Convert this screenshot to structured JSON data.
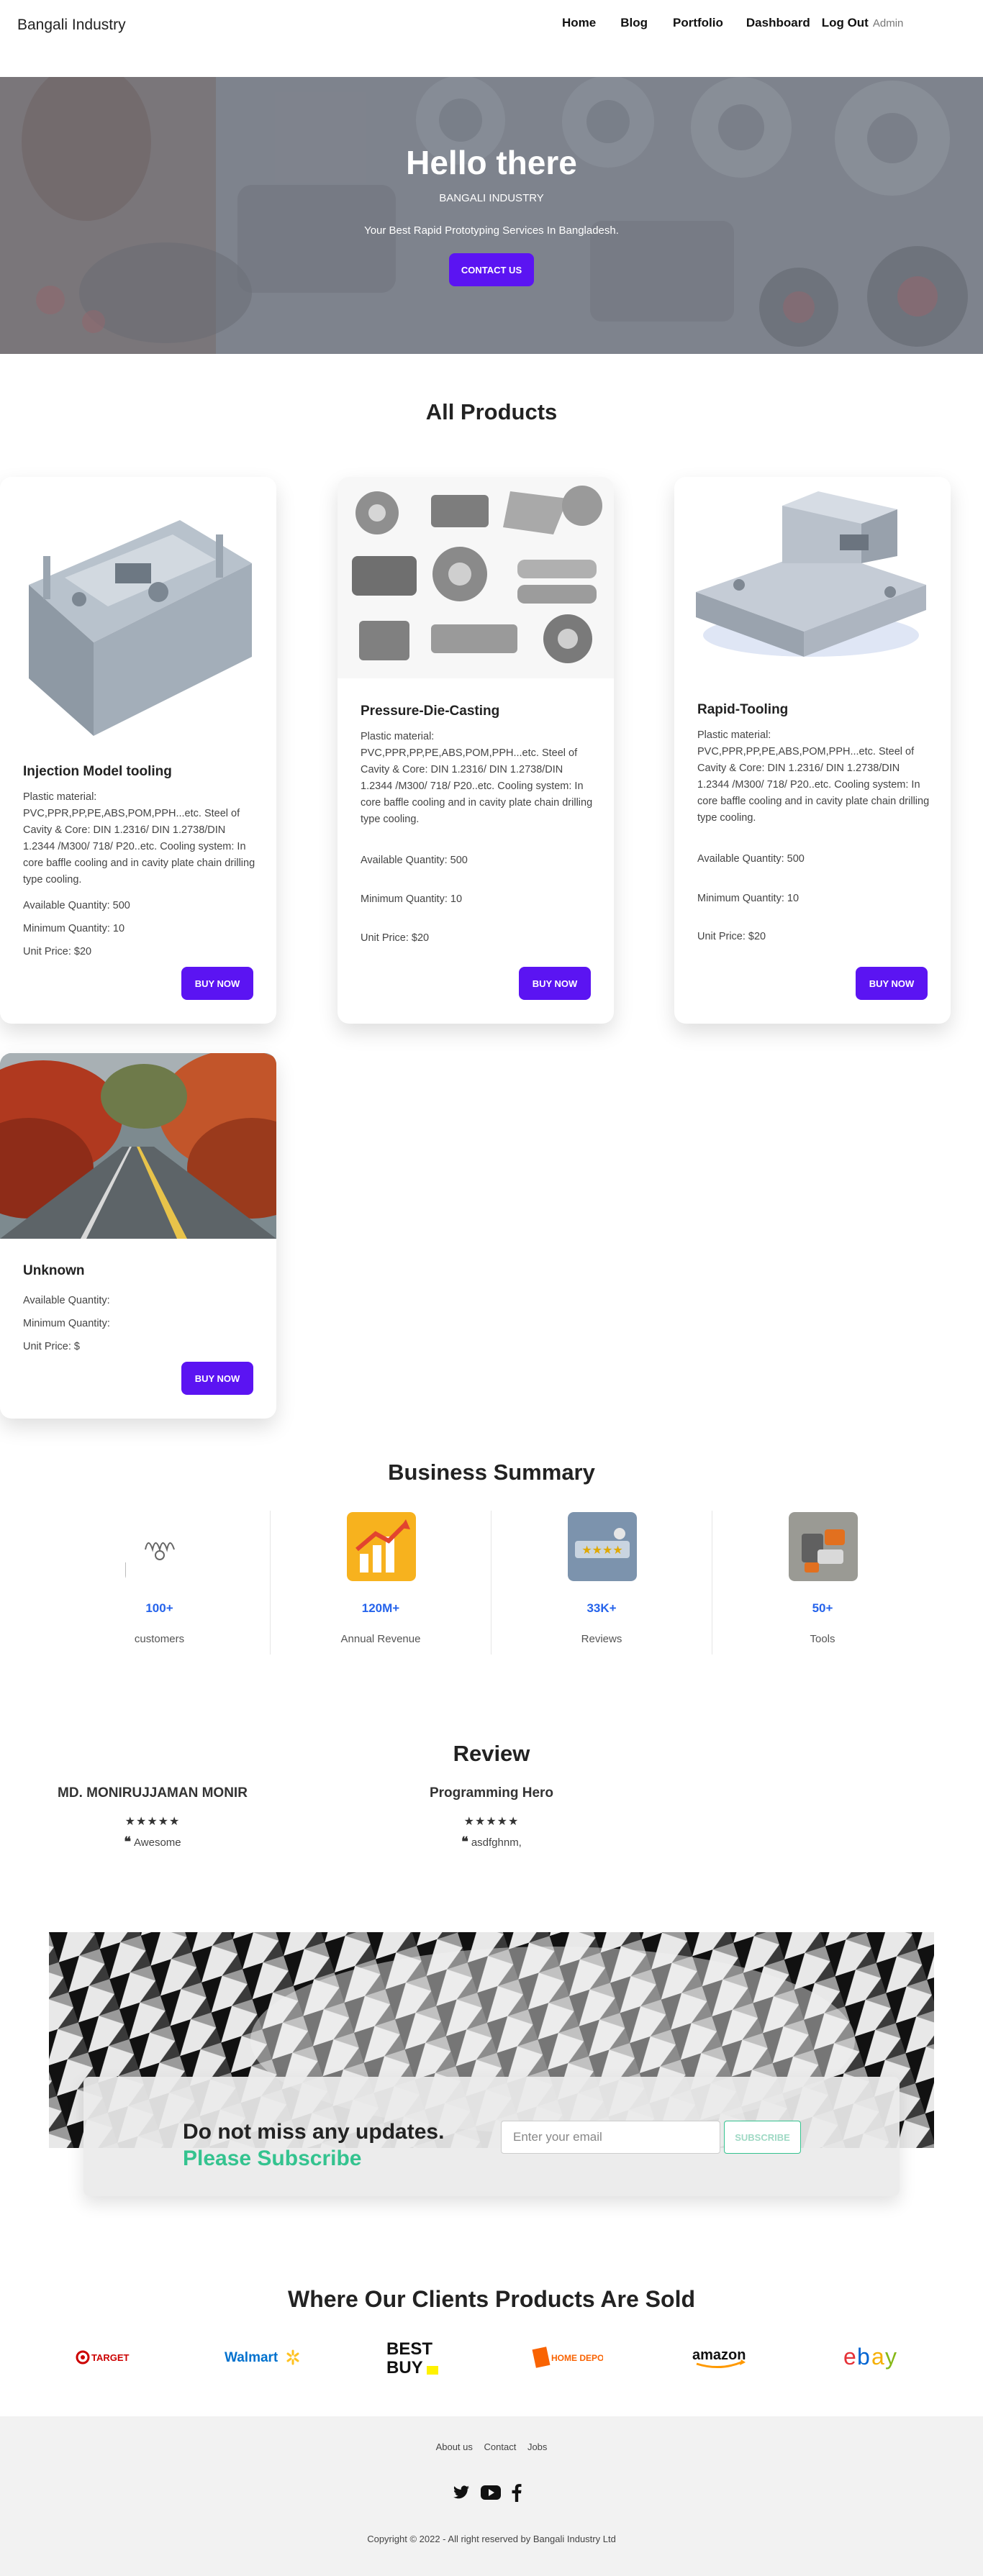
{
  "nav": {
    "brand": "Bangali Industry",
    "links": [
      "Home",
      "Blog",
      "Portfolio",
      "Dashboard",
      "Log Out"
    ],
    "user": "Admin"
  },
  "hero": {
    "title": "Hello there",
    "subtitle": "BANGALI INDUSTRY",
    "tagline": "Your Best Rapid Prototyping Services In Bangladesh.",
    "button": "CONTACT US"
  },
  "products": {
    "title": "All Products",
    "buy_label": "BUY NOW",
    "items": [
      {
        "name": "Injection Model tooling",
        "description": "Plastic material: PVC,PPR,PP,PE,ABS,POM,PPH...etc. Steel of Cavity & Core: DIN 1.2316/ DIN 1.2738/DIN 1.2344 /M300/ 718/ P20..etc. Cooling system: In core baffle cooling and in cavity plate chain drilling type cooling.",
        "available": "Available Quantity: 500",
        "minimum": "Minimum Quantity: 10",
        "price": "Unit Price: $20"
      },
      {
        "name": "Pressure-Die-Casting",
        "description": "Plastic material: PVC,PPR,PP,PE,ABS,POM,PPH...etc. Steel of Cavity & Core: DIN 1.2316/ DIN 1.2738/DIN 1.2344 /M300/ 718/ P20..etc. Cooling system: In core baffle cooling and in cavity plate chain drilling type cooling.",
        "available": "Available Quantity: 500",
        "minimum": "Minimum Quantity: 10",
        "price": "Unit Price: $20"
      },
      {
        "name": "Rapid-Tooling",
        "description": "Plastic material: PVC,PPR,PP,PE,ABS,POM,PPH...etc. Steel of Cavity & Core: DIN 1.2316/ DIN 1.2738/DIN 1.2344 /M300/ 718/ P20..etc. Cooling system: In core baffle cooling and in cavity plate chain drilling type cooling.",
        "available": "Available Quantity: 500",
        "minimum": "Minimum Quantity: 10",
        "price": "Unit Price: $20"
      },
      {
        "name": "Unknown",
        "description": "",
        "available": "Available Quantity:",
        "minimum": "Minimum Quantity:",
        "price": "Unit Price: $"
      }
    ]
  },
  "summary": {
    "title": "Business Summary",
    "items": [
      {
        "value": "100+",
        "label": "customers",
        "icon": "customers-icon"
      },
      {
        "value": "120M+",
        "label": "Annual Revenue",
        "icon": "revenue-chart-icon"
      },
      {
        "value": "33K+",
        "label": "Reviews",
        "icon": "reviews-icon"
      },
      {
        "value": "50+",
        "label": "Tools",
        "icon": "tools-icon"
      }
    ]
  },
  "reviews": {
    "title": "Review",
    "stars": "★★★★★",
    "quote_icon": "❝",
    "items": [
      {
        "name": "MD. MONIRUJJAMAN MONIR",
        "text": "Awesome"
      },
      {
        "name": "Programming Hero",
        "text": "asdfghnm,"
      }
    ]
  },
  "newsletter": {
    "title": "Do not miss any updates.",
    "subtitle": "Please Subscribe",
    "placeholder": "Enter your email",
    "button": "SUBSCRIBE"
  },
  "clients": {
    "title": "Where Our Clients Products Are Sold",
    "logos": [
      "TARGET",
      "Walmart",
      "BEST BUY",
      "HOME DEPOT",
      "amazon",
      "ebay"
    ]
  },
  "footer": {
    "links": [
      "About us",
      "Contact",
      "Jobs"
    ],
    "social": [
      "twitter-icon",
      "youtube-icon",
      "facebook-icon"
    ],
    "copyright": "Copyright © 2022 - All right reserved by Bangali Industry Ltd"
  },
  "colors": {
    "primary": "#5b14f2",
    "accent_green": "#34c38f",
    "stat_blue": "#2563eb",
    "footer_bg": "#f2f2f2"
  }
}
